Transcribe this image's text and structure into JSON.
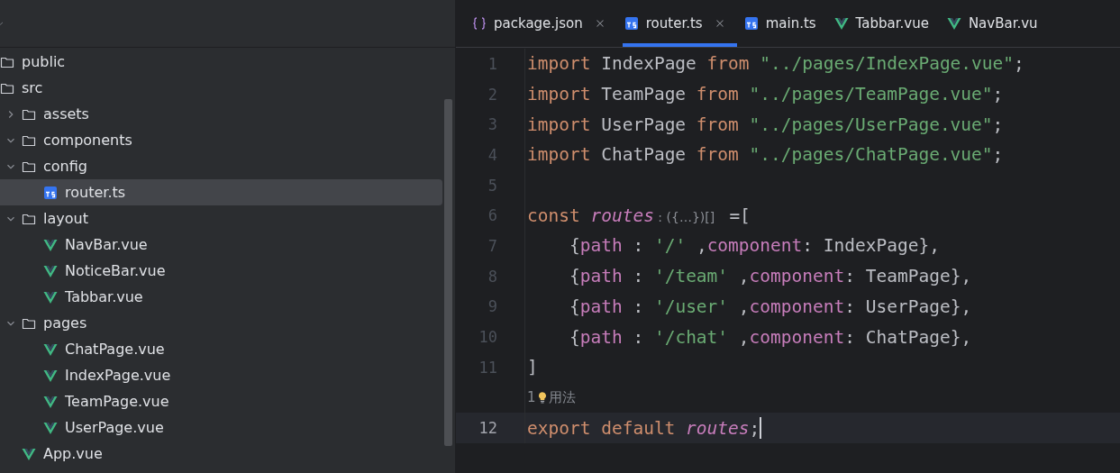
{
  "project_tree": {
    "items": [
      {
        "name": "public",
        "kind": "folder"
      },
      {
        "name": "src",
        "kind": "folder",
        "children": [
          {
            "name": "assets",
            "kind": "folder",
            "expanded": false
          },
          {
            "name": "components",
            "kind": "folder",
            "expanded": true
          },
          {
            "name": "config",
            "kind": "folder",
            "expanded": true,
            "children": [
              {
                "name": "router.ts",
                "kind": "ts",
                "selected": true
              }
            ]
          },
          {
            "name": "layout",
            "kind": "folder",
            "expanded": true,
            "children": [
              {
                "name": "NavBar.vue",
                "kind": "vue",
                "selected": false
              },
              {
                "name": "NoticeBar.vue",
                "kind": "vue",
                "selected": false
              },
              {
                "name": "Tabbar.vue",
                "kind": "vue",
                "selected": false
              }
            ]
          },
          {
            "name": "pages",
            "kind": "folder",
            "expanded": true,
            "children": [
              {
                "name": "ChatPage.vue",
                "kind": "vue",
                "selected": false
              },
              {
                "name": "IndexPage.vue",
                "kind": "vue",
                "selected": false
              },
              {
                "name": "TeamPage.vue",
                "kind": "vue",
                "selected": false
              },
              {
                "name": "UserPage.vue",
                "kind": "vue",
                "selected": false
              }
            ]
          },
          {
            "name": "App.vue",
            "kind": "vue",
            "selected": false
          }
        ]
      }
    ]
  },
  "tabs": [
    {
      "label": "package.json",
      "kind": "json",
      "selected": false,
      "closable": true
    },
    {
      "label": "router.ts",
      "kind": "ts",
      "selected": true,
      "closable": true
    },
    {
      "label": "main.ts",
      "kind": "ts",
      "selected": false,
      "closable": false
    },
    {
      "label": "Tabbar.vue",
      "kind": "vue",
      "selected": false,
      "closable": false
    },
    {
      "label": "NavBar.vu",
      "kind": "vue",
      "selected": false,
      "closable": false
    }
  ],
  "editor": {
    "lines": [
      {
        "kind": "code",
        "number": "1",
        "current": false,
        "tokens": [
          {
            "kind": "kw",
            "text": "import "
          },
          {
            "kind": "id",
            "text": "IndexPage "
          },
          {
            "kind": "kw",
            "text": "from "
          },
          {
            "kind": "str",
            "text": "\"../pages/IndexPage.vue\""
          },
          {
            "kind": "id",
            "text": ";"
          }
        ]
      },
      {
        "kind": "code",
        "number": "2",
        "current": false,
        "tokens": [
          {
            "kind": "kw",
            "text": "import "
          },
          {
            "kind": "id",
            "text": "TeamPage "
          },
          {
            "kind": "kw",
            "text": "from "
          },
          {
            "kind": "str",
            "text": "\"../pages/TeamPage.vue\""
          },
          {
            "kind": "id",
            "text": ";"
          }
        ]
      },
      {
        "kind": "code",
        "number": "3",
        "current": false,
        "tokens": [
          {
            "kind": "kw",
            "text": "import "
          },
          {
            "kind": "id",
            "text": "UserPage "
          },
          {
            "kind": "kw",
            "text": "from "
          },
          {
            "kind": "str",
            "text": "\"../pages/UserPage.vue\""
          },
          {
            "kind": "id",
            "text": ";"
          }
        ]
      },
      {
        "kind": "code",
        "number": "4",
        "current": false,
        "tokens": [
          {
            "kind": "kw",
            "text": "import "
          },
          {
            "kind": "id",
            "text": "ChatPage "
          },
          {
            "kind": "kw",
            "text": "from "
          },
          {
            "kind": "str",
            "text": "\"../pages/ChatPage.vue\""
          },
          {
            "kind": "id",
            "text": ";"
          }
        ]
      },
      {
        "kind": "code",
        "number": "5",
        "current": false
      },
      {
        "kind": "code",
        "number": "6",
        "current": false,
        "tokens": [
          {
            "kind": "kw",
            "text": "const "
          },
          {
            "kind": "var",
            "text": "routes"
          },
          {
            "kind": "inlay",
            "text": " : ({…})[] "
          },
          {
            "kind": "id",
            "text": " =["
          }
        ]
      },
      {
        "kind": "code",
        "number": "7",
        "current": false,
        "tokens": [
          {
            "kind": "id",
            "text": "    {"
          },
          {
            "kind": "prop",
            "text": "path"
          },
          {
            "kind": "id",
            "text": " : "
          },
          {
            "kind": "str",
            "text": "'/'"
          },
          {
            "kind": "id",
            "text": " ,"
          },
          {
            "kind": "prop",
            "text": "component"
          },
          {
            "kind": "id",
            "text": ": IndexPage},"
          }
        ]
      },
      {
        "kind": "code",
        "number": "8",
        "current": false,
        "tokens": [
          {
            "kind": "id",
            "text": "    {"
          },
          {
            "kind": "prop",
            "text": "path"
          },
          {
            "kind": "id",
            "text": " : "
          },
          {
            "kind": "str",
            "text": "'/team'"
          },
          {
            "kind": "id",
            "text": " ,"
          },
          {
            "kind": "prop",
            "text": "component"
          },
          {
            "kind": "id",
            "text": ": TeamPage},"
          }
        ]
      },
      {
        "kind": "code",
        "number": "9",
        "current": false,
        "tokens": [
          {
            "kind": "id",
            "text": "    {"
          },
          {
            "kind": "prop",
            "text": "path"
          },
          {
            "kind": "id",
            "text": " : "
          },
          {
            "kind": "str",
            "text": "'/user'"
          },
          {
            "kind": "id",
            "text": " ,"
          },
          {
            "kind": "prop",
            "text": "component"
          },
          {
            "kind": "id",
            "text": ": UserPage},"
          }
        ]
      },
      {
        "kind": "code",
        "number": "10",
        "current": false,
        "tokens": [
          {
            "kind": "id",
            "text": "    {"
          },
          {
            "kind": "prop",
            "text": "path"
          },
          {
            "kind": "id",
            "text": " : "
          },
          {
            "kind": "str",
            "text": "'/chat'"
          },
          {
            "kind": "id",
            "text": " ,"
          },
          {
            "kind": "prop",
            "text": "component"
          },
          {
            "kind": "id",
            "text": ": ChatPage},"
          }
        ]
      },
      {
        "kind": "code",
        "number": "11",
        "current": false,
        "tokens": [
          {
            "kind": "id",
            "text": "]"
          }
        ]
      },
      {
        "kind": "hint",
        "count": "1",
        "label": "用法"
      },
      {
        "kind": "code",
        "number": "12",
        "current": true,
        "tokens": [
          {
            "kind": "kw",
            "text": "export default "
          },
          {
            "kind": "var",
            "text": "routes"
          },
          {
            "kind": "id",
            "text": ";"
          }
        ]
      }
    ]
  }
}
